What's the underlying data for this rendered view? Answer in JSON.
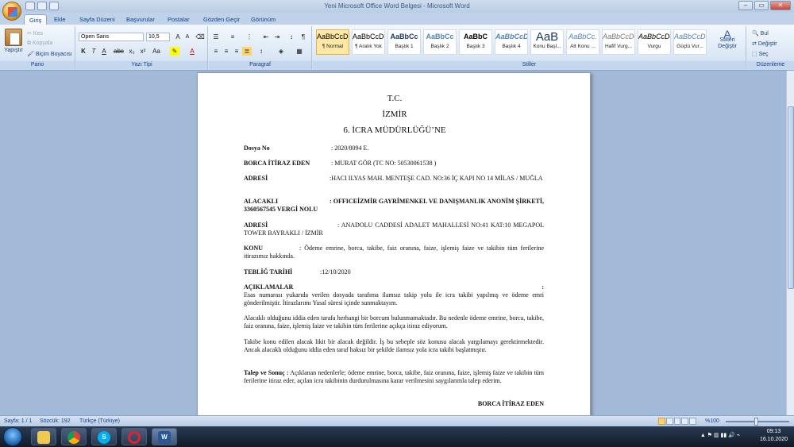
{
  "window": {
    "title": "Yeni Microsoft Office Word Belgesi - Microsoft Word",
    "min": "–",
    "max": "▭",
    "close": "✕"
  },
  "tabs": [
    "Giriş",
    "Ekle",
    "Sayfa Düzeni",
    "Başvurular",
    "Postalar",
    "Gözden Geçir",
    "Görünüm"
  ],
  "ribbon": {
    "clipboard": {
      "paste": "Yapıştır",
      "cut": "Kes",
      "copy": "Kopyala",
      "format_painter": "Biçim Boyacısı",
      "label": "Pano"
    },
    "font": {
      "name": "Open Sans",
      "size": "10,5",
      "label": "Yazı Tipi"
    },
    "paragraph": {
      "label": "Paragraf"
    },
    "styles": {
      "label": "Stiller",
      "items": [
        {
          "preview": "AaBbCcDc",
          "name": "¶ Normal"
        },
        {
          "preview": "AaBbCcDc",
          "name": "¶ Aralık Yok"
        },
        {
          "preview": "AaBbCc",
          "name": "Başlık 1"
        },
        {
          "preview": "AaBbCc",
          "name": "Başlık 2"
        },
        {
          "preview": "AaBbC",
          "name": "Başlık 3"
        },
        {
          "preview": "AaBbCcD",
          "name": "Başlık 4"
        },
        {
          "preview": "AaB",
          "name": "Konu Başl..."
        },
        {
          "preview": "AaBbCc.",
          "name": "Alt Konu ..."
        },
        {
          "preview": "AaBbCcDc",
          "name": "Hafif Vurg..."
        },
        {
          "preview": "AaBbCcDc",
          "name": "Vurgu"
        },
        {
          "preview": "AaBbCcDc",
          "name": "Güçlü Vur..."
        }
      ],
      "change_styles": "Stilleri Değiştir"
    },
    "editing": {
      "find": "Bul",
      "replace": "Değiştir",
      "select": "Seç",
      "label": "Düzenleme"
    }
  },
  "document": {
    "h1": "T.C.",
    "h2": "İZMİR",
    "h3": "6. İCRA MÜDÜRLÜĞÜ’NE",
    "dosya_label": "Dosya No",
    "dosya_val": ": 2020/8094 E.",
    "borca_label": "BORCA İTİRAZ EDEN",
    "borca_val": ": MURAT GÖR (TC NO: 50530061538 )",
    "adres1_label": "ADRESİ",
    "adres1_val": ":HACI ILYAS MAH. MENTEŞE CAD. NO:36 İÇ KAPI NO 14 MİLAS / MUĞLA",
    "alacakli_label": "ALACAKLI",
    "alacakli_val": ": OFFICEİZMİR GAYRİMENKEL VE DANIŞMANLIK ANONİM ŞİRKETİ, 3360567545 VERGİ NOLU",
    "adres2_label": "ADRESİ",
    "adres2_val": ": ANADOLU CADDESİ ADALET MAHALLESİ NO:41 KAT:10 MEGAPOL TOWER BAYRAKLI / İZMİR",
    "konu_label": "KONU",
    "konu_val": ": Ödeme emrine, borca, takibe, faiz oranına, faize, işlemiş faize ve takibin tüm ferilerine itirazımız hakkında.",
    "teblig_label": "TEBLİĞ TARİHİ",
    "teblig_val": ":12/10/2020",
    "aciklamalar": "AÇIKLAMALAR",
    "para1": "Esas numarası yukarıda verilen dosyada tarafıma ilamsız takip yolu ile icra takibi yapılmış ve ödeme emri gönderilmiştir. İtirazlarımı Yasal süresi içinde sunmaktayım.",
    "para2": "Alacaklı olduğunu iddia eden tarafa herhangi bir borcum bulunmamaktadır. Bu nedenle ödeme emrine, borca, takibe, faiz oranına, faize, işlemiş faize ve takibin tüm ferilerine açıkça itiraz ediyorum.",
    "para3": "Takibe konu edilen alacak likit bir alacak değildir. İş bu sebeple söz konusu alacak yargılamayı gerektirmektedir. Ancak alacaklı olduğunu iddia eden taraf haksız bir şekilde ilamsız yola icra takibi başlatmıştır.",
    "talep_label": "Talep ve Sonuç :",
    "talep_val": "Açıklanan nedenlerle; ödeme emrine, borca, takibe, faiz oranına, faize, işlemiş faize ve takibin tüm ferilerine itiraz eder, açılan icra takibinin durdurulmasına karar verilmesini saygılarımla talep ederim.",
    "signature": "BORCA İTİRAZ EDEN"
  },
  "status": {
    "page": "Sayfa: 1 / 1",
    "words": "Sözcük: 192",
    "lang": "Türkçe (Türkiye)",
    "zoom": "%100"
  },
  "taskbar": {
    "time": "09:13",
    "date": "16.10.2020"
  }
}
